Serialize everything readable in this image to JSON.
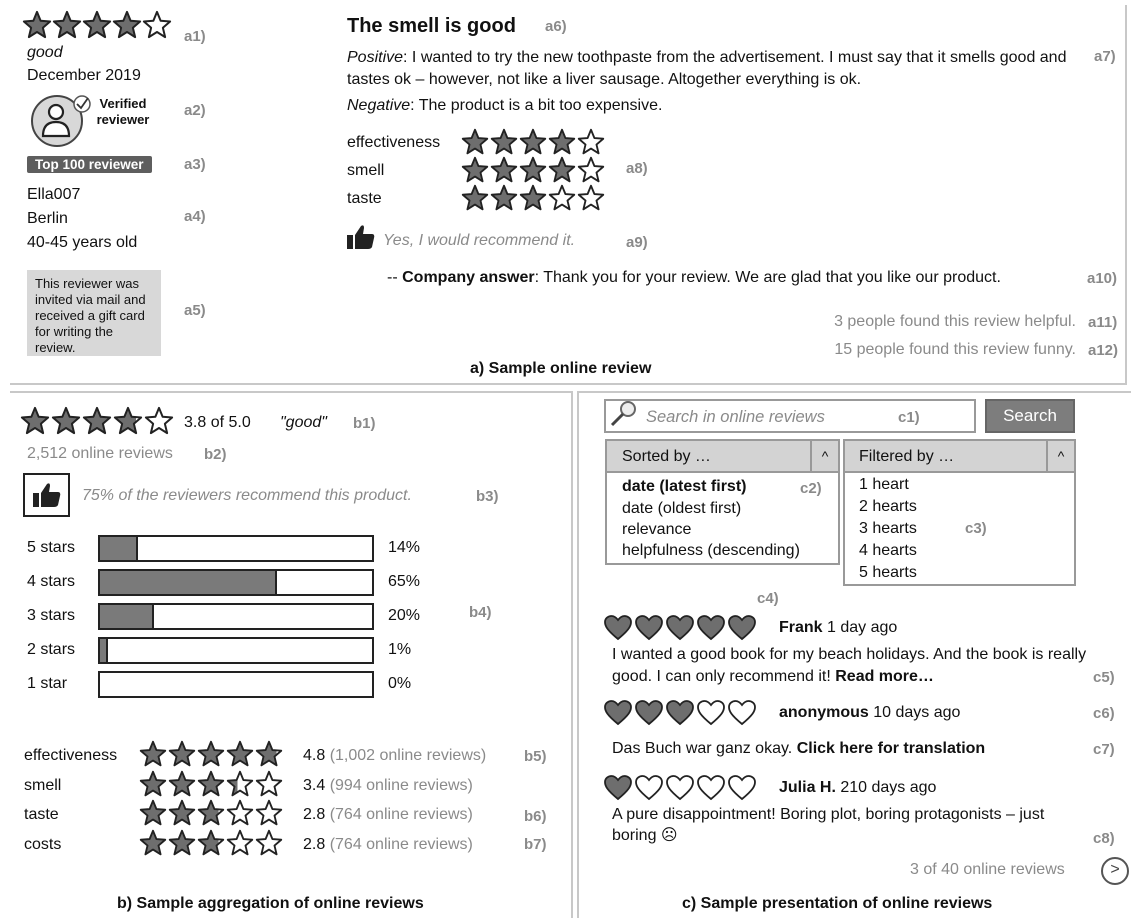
{
  "panel_a": {
    "caption": "a) Sample online review",
    "rating_stars": 4,
    "rating_word": "good",
    "date": "December 2019",
    "verified_text": "Verified reviewer",
    "top_badge": "Top 100 reviewer",
    "username": "Ella007",
    "city": "Berlin",
    "age": "40-45 years old",
    "invite_note": "This reviewer was invited via mail and received a gift card for writing the review.",
    "title": "The smell is good",
    "positive_label": "Positive",
    "positive_text": ": I wanted to try the new toothpaste from the advertisement. I must say that it smells good and tastes ok – however, not like a liver sausage. Altogether everything is ok.",
    "negative_label": "Negative",
    "negative_text": ": The product is a bit too expensive.",
    "aspects": [
      {
        "name": "effectiveness",
        "stars": 4
      },
      {
        "name": "smell",
        "stars": 4
      },
      {
        "name": "taste",
        "stars": 3
      }
    ],
    "recommend": "Yes, I would recommend it.",
    "company_prefix": "-- ",
    "company_label": "Company answer",
    "company_text": ": Thank you for your review. We are glad that you like our product.",
    "helpful": "3 people found this review helpful.",
    "funny": "15 people found this review funny.",
    "labels": {
      "a1": "a1)",
      "a2": "a2)",
      "a3": "a3)",
      "a4": "a4)",
      "a5": "a5)",
      "a6": "a6)",
      "a7": "a7)",
      "a8": "a8)",
      "a9": "a9)",
      "a10": "a10)",
      "a11": "a11)",
      "a12": "a12)"
    }
  },
  "panel_b": {
    "caption": "b) Sample aggregation of online reviews",
    "avg_stars": 3.8,
    "avg_text": "3.8 of 5.0",
    "avg_word": "\"good\"",
    "review_count": "2,512 online reviews",
    "recommend_text": "75% of the reviewers recommend this product.",
    "distribution": [
      {
        "label": "5 stars",
        "pct": 14,
        "pct_text": "14%"
      },
      {
        "label": "4 stars",
        "pct": 65,
        "pct_text": "65%"
      },
      {
        "label": "3 stars",
        "pct": 20,
        "pct_text": "20%"
      },
      {
        "label": "2 stars",
        "pct": 1,
        "pct_text": "1%"
      },
      {
        "label": "1 star",
        "pct": 0,
        "pct_text": "0%"
      }
    ],
    "aspects": [
      {
        "name": "effectiveness",
        "stars": 4.8,
        "score": "4.8",
        "count": "(1,002 online reviews)"
      },
      {
        "name": "smell",
        "stars": 3.4,
        "score": "3.4",
        "count": "(994 online reviews)"
      },
      {
        "name": "taste",
        "stars": 2.8,
        "score": "2.8",
        "count": "(764 online reviews)"
      },
      {
        "name": "costs",
        "stars": 2.8,
        "score": "2.8",
        "count": "(764 online reviews)"
      }
    ],
    "labels": {
      "b1": "b1)",
      "b2": "b2)",
      "b3": "b3)",
      "b4": "b4)",
      "b5": "b5)",
      "b6": "b6)",
      "b7": "b7)"
    }
  },
  "panel_c": {
    "caption": "c) Sample presentation of online reviews",
    "search_placeholder": "Search in online reviews",
    "search_button": "Search",
    "sort_header": "Sorted by …",
    "sort_options": [
      "date (latest first)",
      "date (oldest first)",
      "relevance",
      "helpfulness (descending)"
    ],
    "filter_header": "Filtered by …",
    "filter_options": [
      "1 heart",
      "2 hearts",
      "3 hearts",
      "4 hearts",
      "5 hearts"
    ],
    "caret": "^",
    "reviews": [
      {
        "hearts": 5,
        "name": "Frank",
        "when": " 1 day ago",
        "text": "I wanted a good book for my beach holidays. And the book is really good. I can only recommend it! ",
        "link": "Read more…"
      },
      {
        "hearts": 3,
        "name": "anonymous",
        "when": " 10 days ago",
        "text": "Das Buch war ganz okay. ",
        "link": "Click here for translation"
      },
      {
        "hearts": 1,
        "name": "Julia H.",
        "when": " 210 days ago",
        "text": "A pure disappointment! Boring plot, boring protagonists – just boring ☹",
        "link": ""
      }
    ],
    "page_info": "3 of 40 online reviews",
    "next_glyph": ">",
    "labels": {
      "c1": "c1)",
      "c2": "c2)",
      "c3": "c3)",
      "c4": "c4)",
      "c5": "c5)",
      "c6": "c6)",
      "c7": "c7)",
      "c8": "c8)"
    }
  },
  "colors": {
    "star_fill": "#6e6e6e",
    "star_stroke": "#222222",
    "panel_border": "#c8c8c8"
  }
}
